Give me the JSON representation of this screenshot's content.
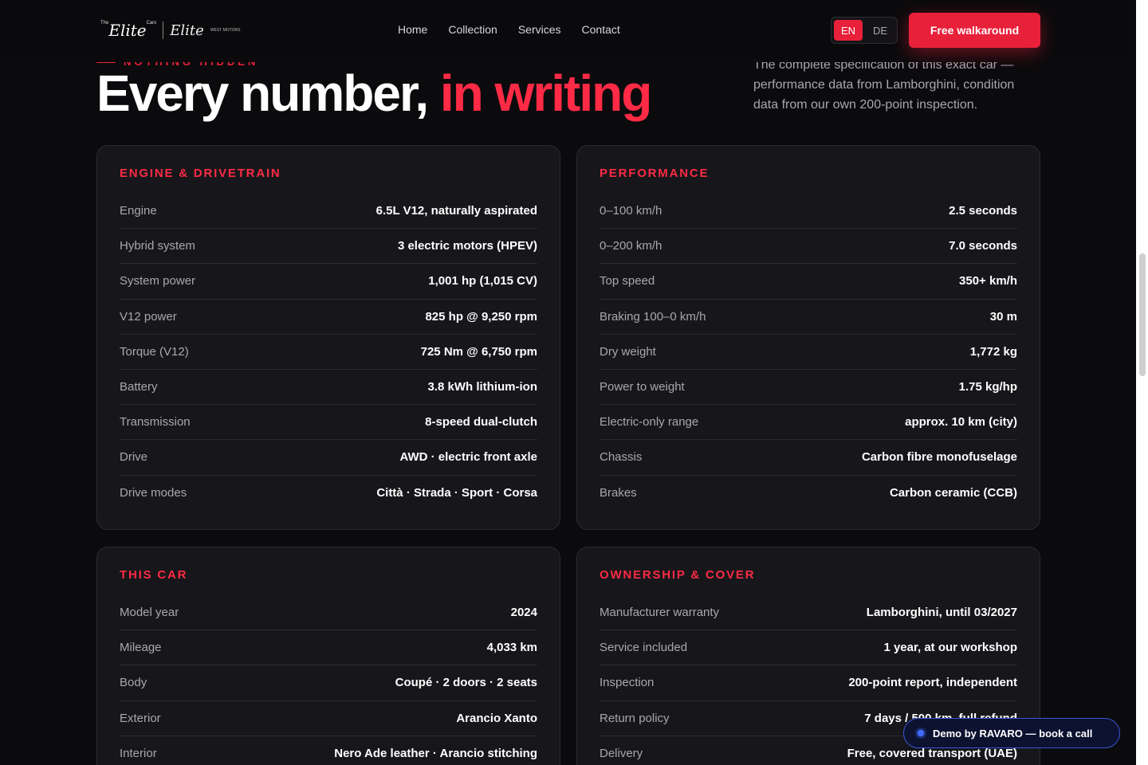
{
  "header": {
    "logo": {
      "prefix": "The",
      "main": "Elite",
      "suffix": "Cars",
      "signature": "Elite",
      "small": "WEST MOTORS"
    },
    "nav": [
      "Home",
      "Collection",
      "Services",
      "Contact"
    ],
    "languages": [
      {
        "label": "EN",
        "active": true
      },
      {
        "label": "DE",
        "active": false
      }
    ],
    "cta_label": "Free walkaround"
  },
  "hero": {
    "eyebrow": "NOTHING HIDDEN",
    "title_main": "Every number, ",
    "title_accent": "in writing",
    "lede": "The complete specification of this exact car — performance data from Lamborghini, condition data from our own 200-point inspection."
  },
  "cards": [
    {
      "title": "ENGINE & DRIVETRAIN",
      "rows": [
        {
          "label": "Engine",
          "value": "6.5L V12, naturally aspirated"
        },
        {
          "label": "Hybrid system",
          "value": "3 electric motors (HPEV)"
        },
        {
          "label": "System power",
          "value": "1,001 hp (1,015 CV)"
        },
        {
          "label": "V12 power",
          "value": "825 hp @ 9,250 rpm"
        },
        {
          "label": "Torque (V12)",
          "value": "725 Nm @ 6,750 rpm"
        },
        {
          "label": "Battery",
          "value": "3.8 kWh lithium-ion"
        },
        {
          "label": "Transmission",
          "value": "8-speed dual-clutch"
        },
        {
          "label": "Drive",
          "value": "AWD · electric front axle"
        },
        {
          "label": "Drive modes",
          "value": "Città · Strada · Sport · Corsa"
        }
      ]
    },
    {
      "title": "PERFORMANCE",
      "rows": [
        {
          "label": "0–100 km/h",
          "value": "2.5 seconds"
        },
        {
          "label": "0–200 km/h",
          "value": "7.0 seconds"
        },
        {
          "label": "Top speed",
          "value": "350+ km/h"
        },
        {
          "label": "Braking 100–0 km/h",
          "value": "30 m"
        },
        {
          "label": "Dry weight",
          "value": "1,772 kg"
        },
        {
          "label": "Power to weight",
          "value": "1.75 kg/hp"
        },
        {
          "label": "Electric-only range",
          "value": "approx. 10 km (city)"
        },
        {
          "label": "Chassis",
          "value": "Carbon fibre monofuselage"
        },
        {
          "label": "Brakes",
          "value": "Carbon ceramic (CCB)"
        }
      ]
    },
    {
      "title": "THIS CAR",
      "rows": [
        {
          "label": "Model year",
          "value": "2024"
        },
        {
          "label": "Mileage",
          "value": "4,033 km"
        },
        {
          "label": "Body",
          "value": "Coupé · 2 doors · 2 seats"
        },
        {
          "label": "Exterior",
          "value": "Arancio Xanto"
        },
        {
          "label": "Interior",
          "value": "Nero Ade leather · Arancio stitching"
        }
      ]
    },
    {
      "title": "OWNERSHIP & COVER",
      "rows": [
        {
          "label": "Manufacturer warranty",
          "value": "Lamborghini, until 03/2027"
        },
        {
          "label": "Service included",
          "value": "1 year, at our workshop"
        },
        {
          "label": "Inspection",
          "value": "200-point report, independent"
        },
        {
          "label": "Return policy",
          "value": "7 days / 500 km, full refund"
        },
        {
          "label": "Delivery",
          "value": "Free, covered transport (UAE)"
        }
      ]
    }
  ],
  "demo_badge": "Demo by RAVARO — book a call",
  "colors": {
    "accent": "#e8203a",
    "background": "#0b0b0d",
    "card": "#17171b"
  }
}
